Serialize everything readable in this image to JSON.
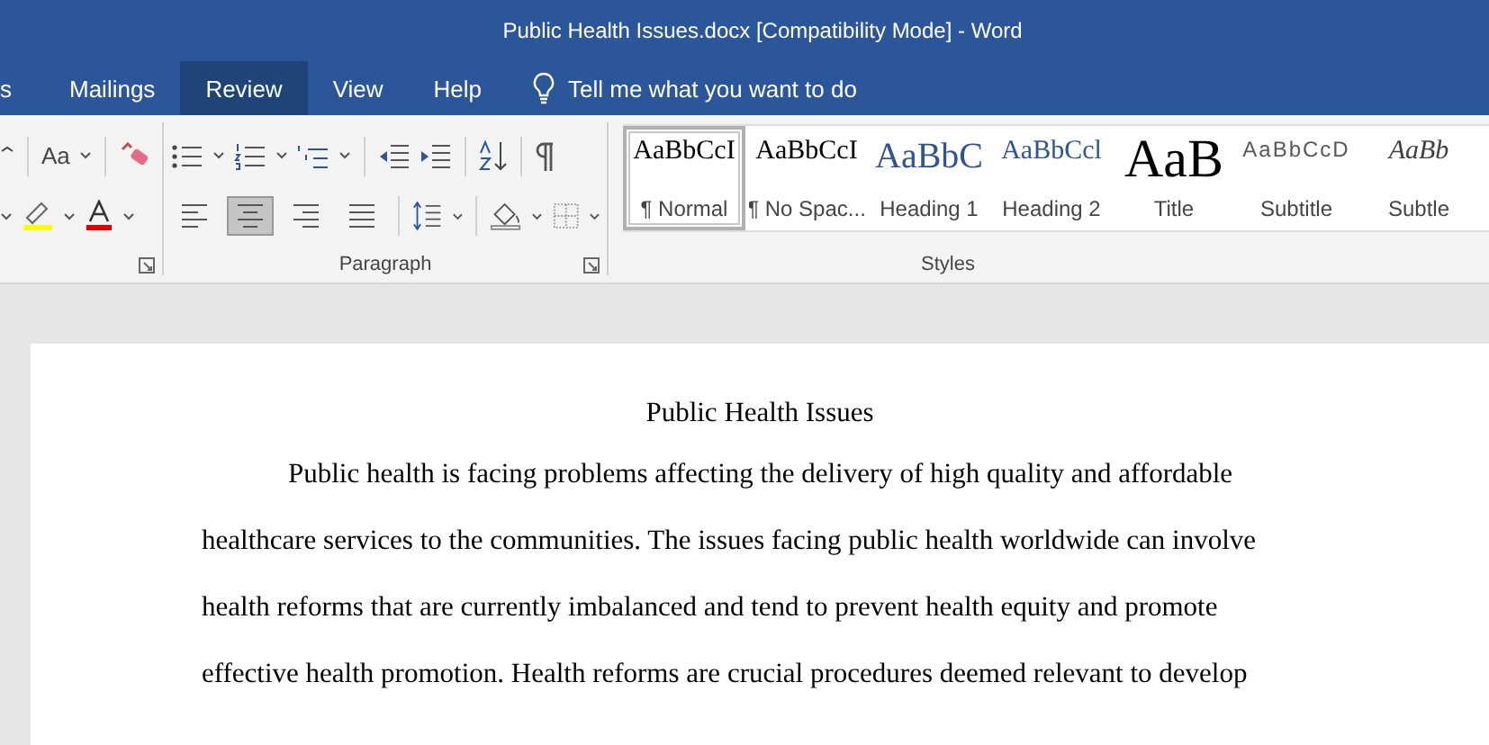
{
  "window": {
    "title": "Public Health Issues.docx [Compatibility Mode]  -  Word"
  },
  "tabs": [
    {
      "label": "s",
      "selected": false
    },
    {
      "label": "Mailings",
      "selected": false
    },
    {
      "label": "Review",
      "selected": true
    },
    {
      "label": "View",
      "selected": false
    },
    {
      "label": "Help",
      "selected": false
    }
  ],
  "tell_me": {
    "placeholder": "Tell me what you want to do"
  },
  "font_group": {
    "case_button": "Aa"
  },
  "paragraph_group": {
    "label": "Paragraph",
    "alignments": [
      {
        "kind": "left",
        "selected": false
      },
      {
        "kind": "center",
        "selected": true
      },
      {
        "kind": "right",
        "selected": false
      },
      {
        "kind": "justify",
        "selected": false
      }
    ]
  },
  "styles_group": {
    "label": "Styles",
    "styles": [
      {
        "preview": "AaBbCcI",
        "label": "¶ Normal",
        "kind": "normal",
        "selected": true
      },
      {
        "preview": "AaBbCcI",
        "label": "¶ No Spac...",
        "kind": "normal",
        "selected": false
      },
      {
        "preview": "AaBbC",
        "label": "Heading 1",
        "kind": "heading1",
        "selected": false
      },
      {
        "preview": "AaBbCcl",
        "label": "Heading 2",
        "kind": "heading2",
        "selected": false
      },
      {
        "preview": "AaB",
        "label": "Title",
        "kind": "title",
        "selected": false
      },
      {
        "preview": "AaBbCcD",
        "label": "Subtitle",
        "kind": "subtitle",
        "selected": false
      },
      {
        "preview": "AaBb",
        "label": "Subtle",
        "kind": "subtle",
        "selected": false
      }
    ]
  },
  "document": {
    "title": "Public Health Issues",
    "paragraph": "Public health is facing problems affecting the delivery of high quality and affordable healthcare services to the communities. The issues facing public health worldwide can involve health reforms that are currently imbalanced and tend to prevent health equity and promote effective health promotion. Health reforms are crucial procedures deemed relevant to develop"
  }
}
